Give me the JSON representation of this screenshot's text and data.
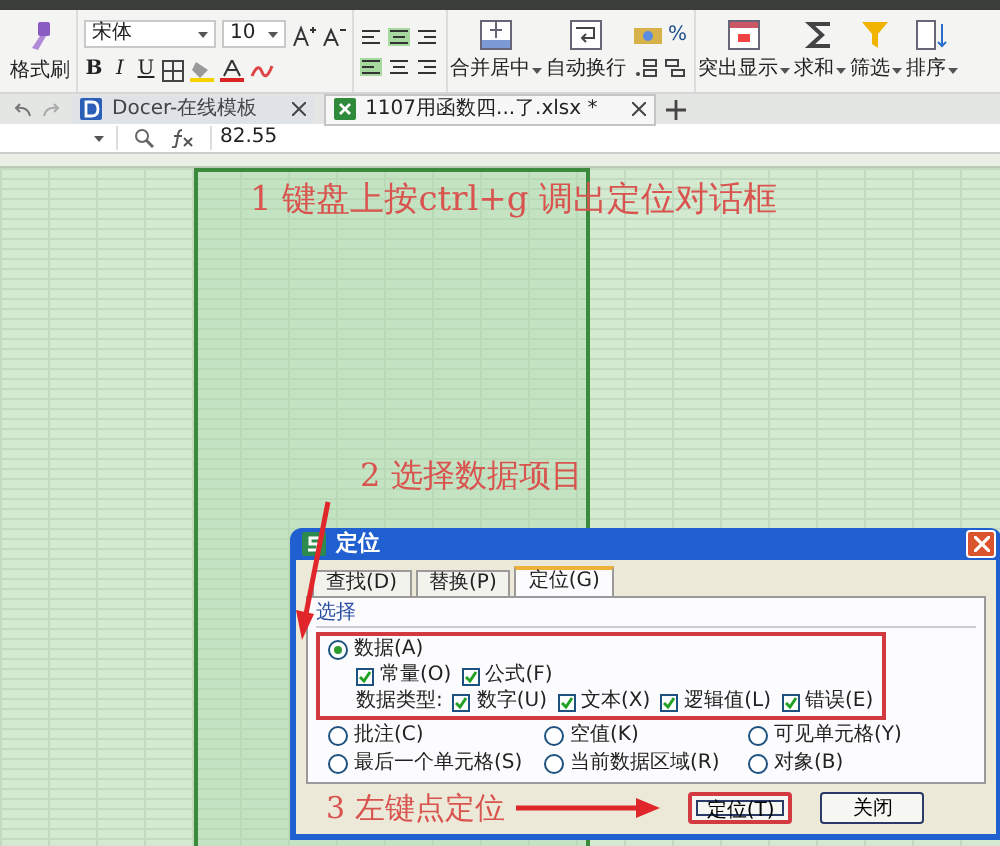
{
  "ribbon": {
    "format_painter": "格式刷",
    "font_name": "宋体",
    "font_size": "10",
    "format_buttons": [
      "B",
      "I",
      "U"
    ],
    "percent": "%",
    "big_buttons": [
      {
        "label": "合并居中",
        "kind": "merge",
        "dropdown": true
      },
      {
        "label": "自动换行",
        "kind": "wrap",
        "dropdown": false
      },
      {
        "label": "突出显示",
        "kind": "highlight",
        "dropdown": true
      },
      {
        "label": "求和",
        "kind": "sum",
        "dropdown": true
      },
      {
        "label": "筛选",
        "kind": "filter",
        "dropdown": true
      },
      {
        "label": "排序",
        "kind": "sort",
        "dropdown": true
      }
    ]
  },
  "tabs": [
    {
      "label": "Docer-在线模板",
      "selected": false
    },
    {
      "label": "1107用函数四...了.xlsx *",
      "selected": true
    }
  ],
  "formula_bar": {
    "value": "82.55"
  },
  "annotations": [
    {
      "text": "1 键盘上按ctrl+g 调出定位对话框",
      "kind": "step1"
    },
    {
      "text": "2 选择数据项目",
      "kind": "step2"
    }
  ],
  "dialog": {
    "title": "定位",
    "tabs": [
      {
        "label": "查找(D)",
        "selected": false
      },
      {
        "label": "替换(P)",
        "selected": false
      },
      {
        "label": "定位(G)",
        "selected": true
      }
    ],
    "section_label": "选择",
    "data_option": {
      "label": "数据(A)",
      "selected": true,
      "highlighted": true
    },
    "data_sources": [
      {
        "label": "常量(O)",
        "checked": true
      },
      {
        "label": "公式(F)",
        "checked": true
      }
    ],
    "data_types_label": "数据类型:",
    "data_types": [
      {
        "label": "数字(U)",
        "checked": true
      },
      {
        "label": "文本(X)",
        "checked": true
      },
      {
        "label": "逻辑值(L)",
        "checked": true
      },
      {
        "label": "错误(E)",
        "checked": true
      }
    ],
    "other_options": [
      {
        "label": "批注(C)",
        "selected": false
      },
      {
        "label": "空值(K)",
        "selected": false
      },
      {
        "label": "可见单元格(Y)",
        "selected": false
      },
      {
        "label": "最后一个单元格(S)",
        "selected": false
      },
      {
        "label": "当前数据区域(R)",
        "selected": false
      },
      {
        "label": "对象(B)",
        "selected": false
      }
    ],
    "note": "3 左键点定位",
    "buttons": [
      {
        "label": "定位(T)",
        "highlighted": true
      },
      {
        "label": "关闭",
        "highlighted": false
      }
    ]
  }
}
